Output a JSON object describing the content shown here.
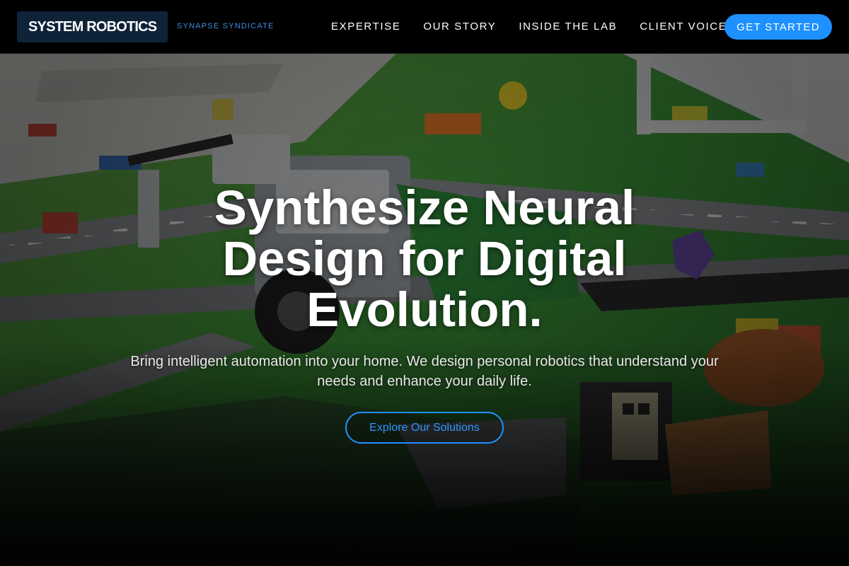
{
  "header": {
    "brand": "SYSTEM ROBOTICS",
    "tagline": "SYNAPSE SYNDICATE",
    "nav": [
      {
        "label": "EXPERTISE"
      },
      {
        "label": "OUR STORY"
      },
      {
        "label": "INSIDE THE LAB"
      },
      {
        "label": "CLIENT VOICE"
      }
    ],
    "cta_label": "GET STARTED"
  },
  "hero": {
    "title": "Synthesize Neural Design for Digital Evolution.",
    "subtitle": "Bring intelligent automation into your home. We design personal robotics that understand your needs and enhance your daily life.",
    "cta_label": "Explore Our Solutions",
    "background": "robotics-mat-scene"
  },
  "colors": {
    "accent": "#1e90ff",
    "brand_bg": "#0e2238",
    "tagline": "#3d8de0",
    "nav_bg": "#000000"
  }
}
